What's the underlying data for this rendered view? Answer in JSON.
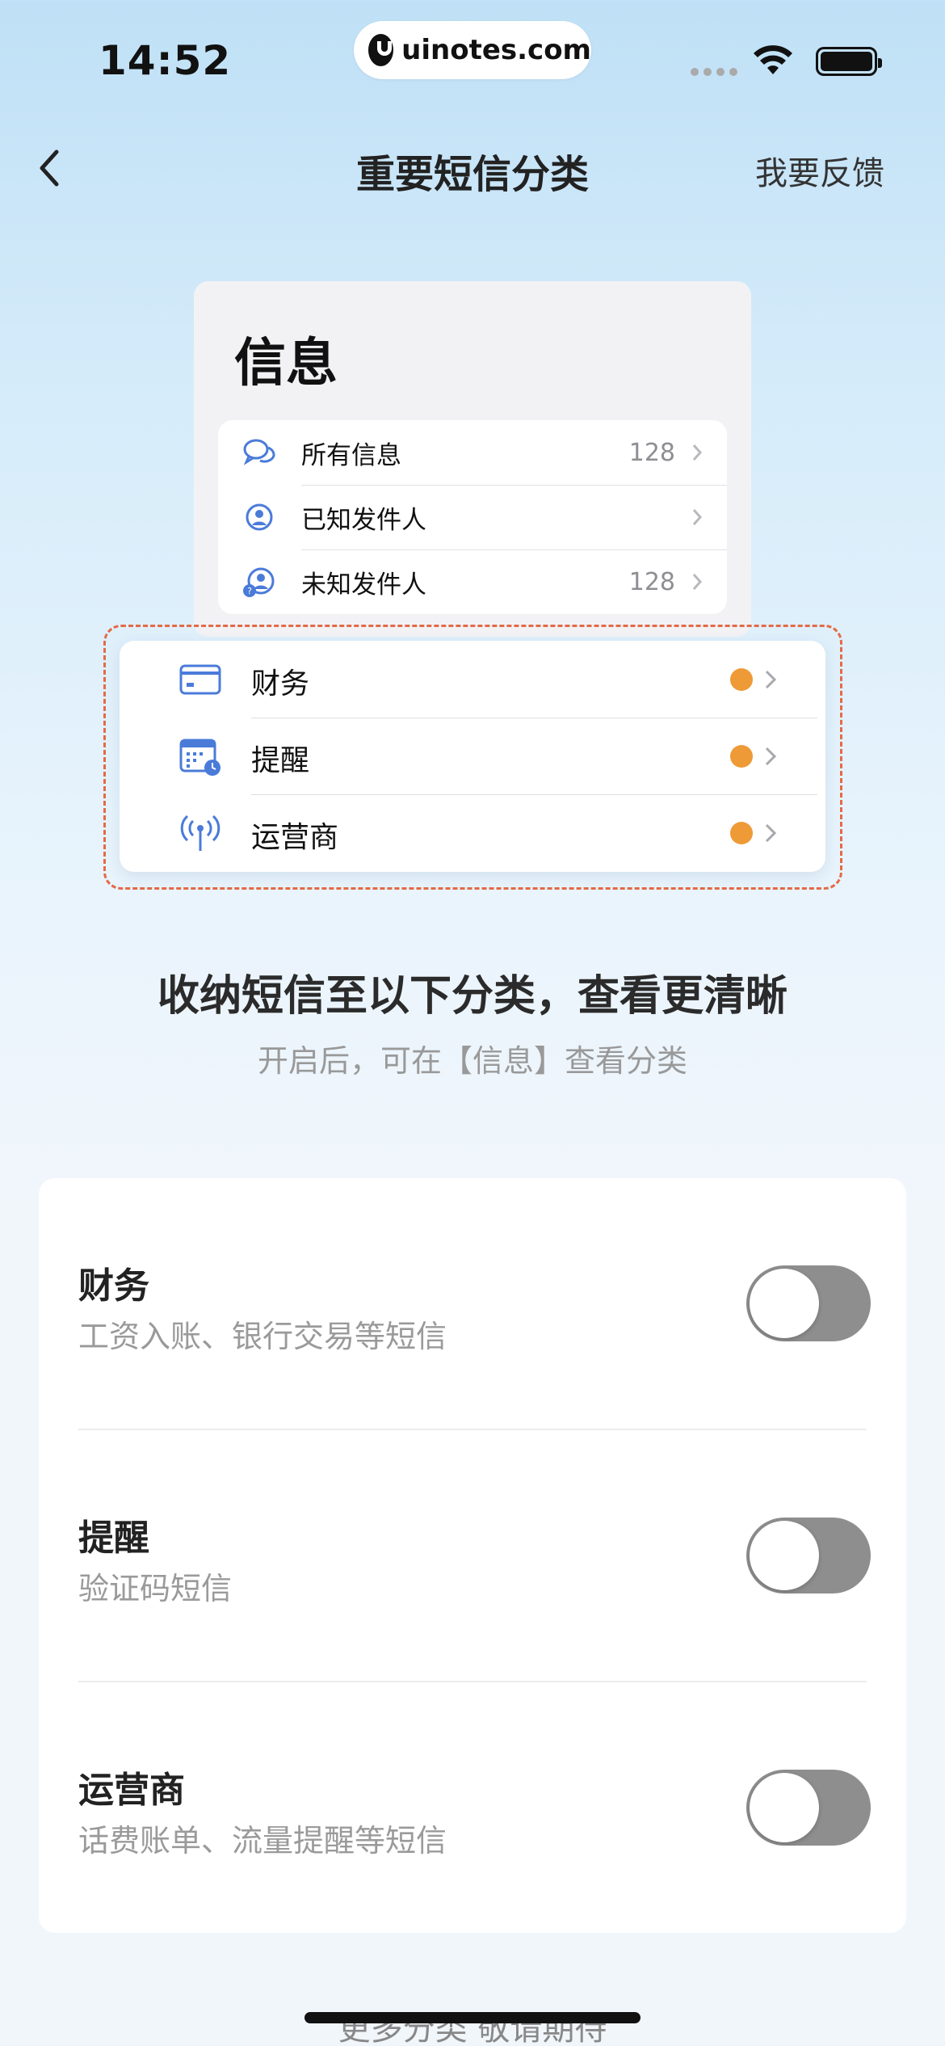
{
  "status": {
    "time": "14:52",
    "url": "uinotes.com"
  },
  "nav": {
    "back_icon": "chevron-left-icon",
    "title": "重要短信分类",
    "feedback": "我要反馈"
  },
  "preview": {
    "title": "信息",
    "list": [
      {
        "label": "所有信息",
        "count": "128",
        "icon": "chat-bubbles-icon"
      },
      {
        "label": "已知发件人",
        "count": "",
        "icon": "person-circle-icon"
      },
      {
        "label": "未知发件人",
        "count": "128",
        "icon": "unknown-person-icon"
      }
    ],
    "categories": [
      {
        "label": "财务",
        "icon": "card-icon"
      },
      {
        "label": "提醒",
        "icon": "calendar-clock-icon"
      },
      {
        "label": "运营商",
        "icon": "antenna-icon"
      }
    ],
    "colors": {
      "dot": "#ee9a36",
      "dash": "#e46a47",
      "icon": "#4a7bd9"
    }
  },
  "headline": "收纳短信至以下分类，查看更清晰",
  "subline": "开启后，可在【信息】查看分类",
  "settings": [
    {
      "title": "财务",
      "desc": "工资入账、银行交易等短信",
      "enabled": false
    },
    {
      "title": "提醒",
      "desc": "验证码短信",
      "enabled": false
    },
    {
      "title": "运营商",
      "desc": "话费账单、流量提醒等短信",
      "enabled": false
    }
  ],
  "footer": "更多分类 敬请期待"
}
